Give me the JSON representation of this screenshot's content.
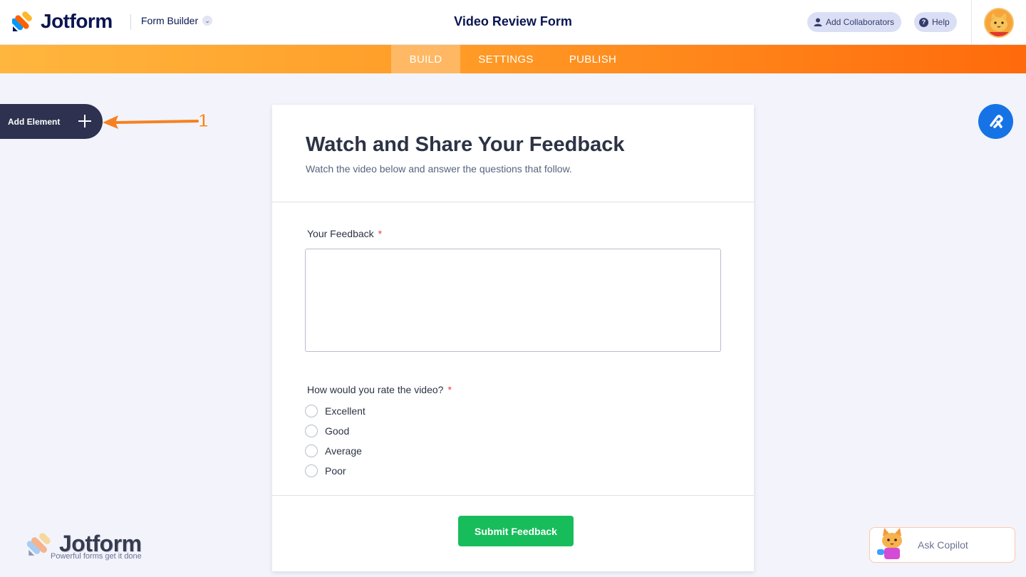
{
  "header": {
    "brand": "Jotform",
    "mode_label": "Form Builder",
    "form_title": "Video Review Form",
    "add_collaborators_label": "Add Collaborators",
    "help_label": "Help"
  },
  "nav": {
    "tabs": [
      {
        "label": "BUILD",
        "active": true
      },
      {
        "label": "SETTINGS",
        "active": false
      },
      {
        "label": "PUBLISH",
        "active": false
      }
    ]
  },
  "sidebar": {
    "add_element_label": "Add Element",
    "annotation_number": "1"
  },
  "form": {
    "heading": "Watch and Share Your Feedback",
    "subheading": "Watch the video below and answer the questions that follow.",
    "questions": [
      {
        "label": "Your Feedback",
        "required": "*",
        "type": "textarea",
        "value": ""
      },
      {
        "label": "How would you rate the video?",
        "required": "*",
        "type": "radio",
        "options": [
          "Excellent",
          "Good",
          "Average",
          "Poor"
        ]
      }
    ],
    "submit_label": "Submit Feedback"
  },
  "footer": {
    "brand": "Jotform",
    "tagline": "Powerful forms get it done"
  },
  "copilot": {
    "label": "Ask Copilot"
  },
  "colors": {
    "nav_gradient_start": "#ffb63e",
    "nav_gradient_end": "#ff6a0b",
    "submit_green": "#18bd5b",
    "accent_blue": "#1673e6",
    "annotation_orange": "#f58220",
    "required_red": "#f23a3c"
  }
}
